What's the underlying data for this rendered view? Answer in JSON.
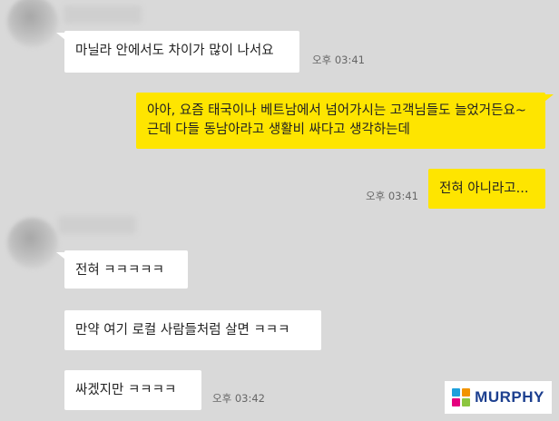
{
  "chat": {
    "messages": [
      {
        "side": "in",
        "text": "마닐라 안에서도 차이가 많이 나서요",
        "time": "오후 03:41"
      },
      {
        "side": "out",
        "text": "아아, 요즘 태국이나 베트남에서 넘어가시는 고객님들도 늘었거든요~ 근데 다들 동남아라고 생활비 싸다고 생각하는데"
      },
      {
        "side": "out",
        "text": "전혀 아니라고...",
        "time": "오후 03:41"
      },
      {
        "side": "in",
        "text": "전혀 ㅋㅋㅋㅋㅋ"
      },
      {
        "side": "in",
        "text": "만약 여기 로컬 사람들처럼 살면 ㅋㅋㅋ"
      },
      {
        "side": "in",
        "text": "싸겠지만 ㅋㅋㅋㅋ",
        "time": "오후 03:42"
      }
    ]
  },
  "watermark": {
    "text": "MURPHY",
    "text_color": "#1c3f8f",
    "mark_colors": [
      "#1ea0db",
      "#f29400",
      "#e5007e",
      "#8cc63f"
    ]
  },
  "colors": {
    "background": "#d9d9d9",
    "incoming_bubble": "#ffffff",
    "outgoing_bubble": "#fee500"
  }
}
